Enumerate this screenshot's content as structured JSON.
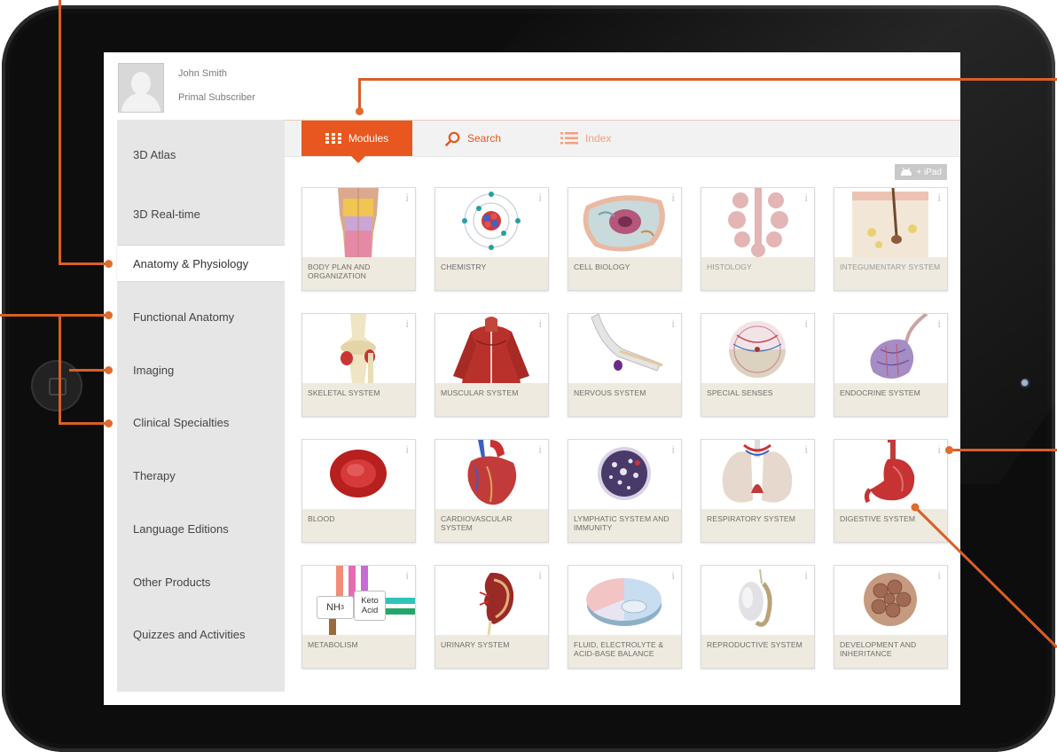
{
  "user": {
    "name": "John Smith",
    "role": "Primal Subscriber"
  },
  "sidebar": {
    "items": [
      {
        "label": "3D Atlas"
      },
      {
        "label": "3D Real-time"
      },
      {
        "label": "Anatomy & Physiology",
        "active": true
      },
      {
        "label": "Functional Anatomy"
      },
      {
        "label": "Imaging"
      },
      {
        "label": "Clinical Specialties"
      },
      {
        "label": "Therapy"
      },
      {
        "label": "Language Editions"
      },
      {
        "label": "Other Products"
      },
      {
        "label": "Quizzes and Activities"
      }
    ]
  },
  "tabs": [
    {
      "label": "Modules",
      "icon": "grid-icon",
      "active": true
    },
    {
      "label": "Search",
      "icon": "search-icon"
    },
    {
      "label": "Index",
      "icon": "list-icon"
    }
  ],
  "badge": {
    "label": "+ iPad",
    "icon": "android-icon"
  },
  "cards": [
    {
      "label": "BODY PLAN AND ORGANIZATION",
      "info": "i"
    },
    {
      "label": "CHEMISTRY",
      "info": "i"
    },
    {
      "label": "CELL BIOLOGY",
      "info": "i"
    },
    {
      "label": "HISTOLOGY",
      "info": "i"
    },
    {
      "label": "INTEGUMENTARY SYSTEM",
      "info": "i"
    },
    {
      "label": "SKELETAL SYSTEM",
      "info": "i"
    },
    {
      "label": "MUSCULAR SYSTEM",
      "info": "i"
    },
    {
      "label": "NERVOUS SYSTEM",
      "info": "i"
    },
    {
      "label": "SPECIAL SENSES",
      "info": "i"
    },
    {
      "label": "ENDOCRINE SYSTEM",
      "info": "i"
    },
    {
      "label": "BLOOD",
      "info": "i"
    },
    {
      "label": "CARDIOVASCULAR SYSTEM",
      "info": "i"
    },
    {
      "label": "LYMPHATIC SYSTEM AND IMMUNITY",
      "info": "i"
    },
    {
      "label": "RESPIRATORY SYSTEM",
      "info": "i"
    },
    {
      "label": "DIGESTIVE SYSTEM",
      "info": "i"
    },
    {
      "label": "METABOLISM",
      "info": "i"
    },
    {
      "label": "URINARY SYSTEM",
      "info": "i"
    },
    {
      "label": "FLUID, ELECTROLYTE & ACID-BASE BALANCE",
      "info": "i"
    },
    {
      "label": "REPRODUCTIVE SYSTEM",
      "info": "i"
    },
    {
      "label": "DEVELOPMENT AND INHERITANCE",
      "info": "i"
    }
  ],
  "metabolism_diagram": {
    "nh3": "NH",
    "nh3_sub": "3",
    "keto": "Keto",
    "acid": "Acid"
  },
  "colors": {
    "accent": "#e8571f",
    "callout": "#d95f27",
    "sidebar": "#e6e6e6",
    "label_bg": "#efeadf"
  }
}
